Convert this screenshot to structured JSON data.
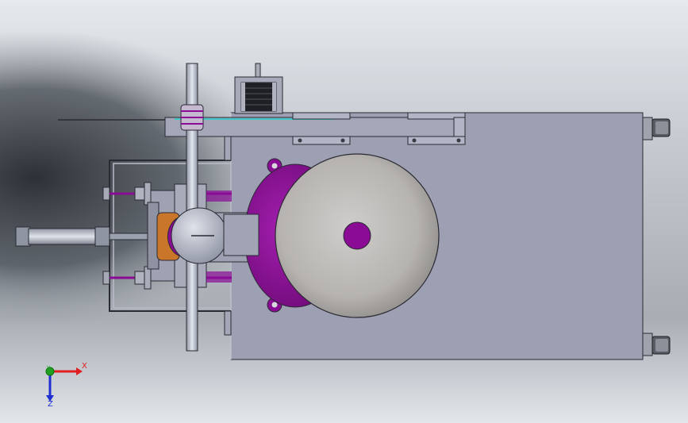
{
  "triad": {
    "x_label": "X",
    "y_label": "Y",
    "z_label": "Z",
    "x_color": "#e02020",
    "y_color": "#20a020",
    "z_color": "#2030d0"
  },
  "colors": {
    "bg_light": "#d6dadf",
    "bg_dark": "#3a3f44",
    "frame_fill": "#9ea1b3",
    "outline": "#2a2a33",
    "purple": "#8a0c95",
    "disc_light": "#c9c7c5",
    "disc_dark": "#8f8c8a",
    "orange": "#c9762a",
    "teal": "#4aa6a6",
    "rod": "#b9bfcc"
  }
}
